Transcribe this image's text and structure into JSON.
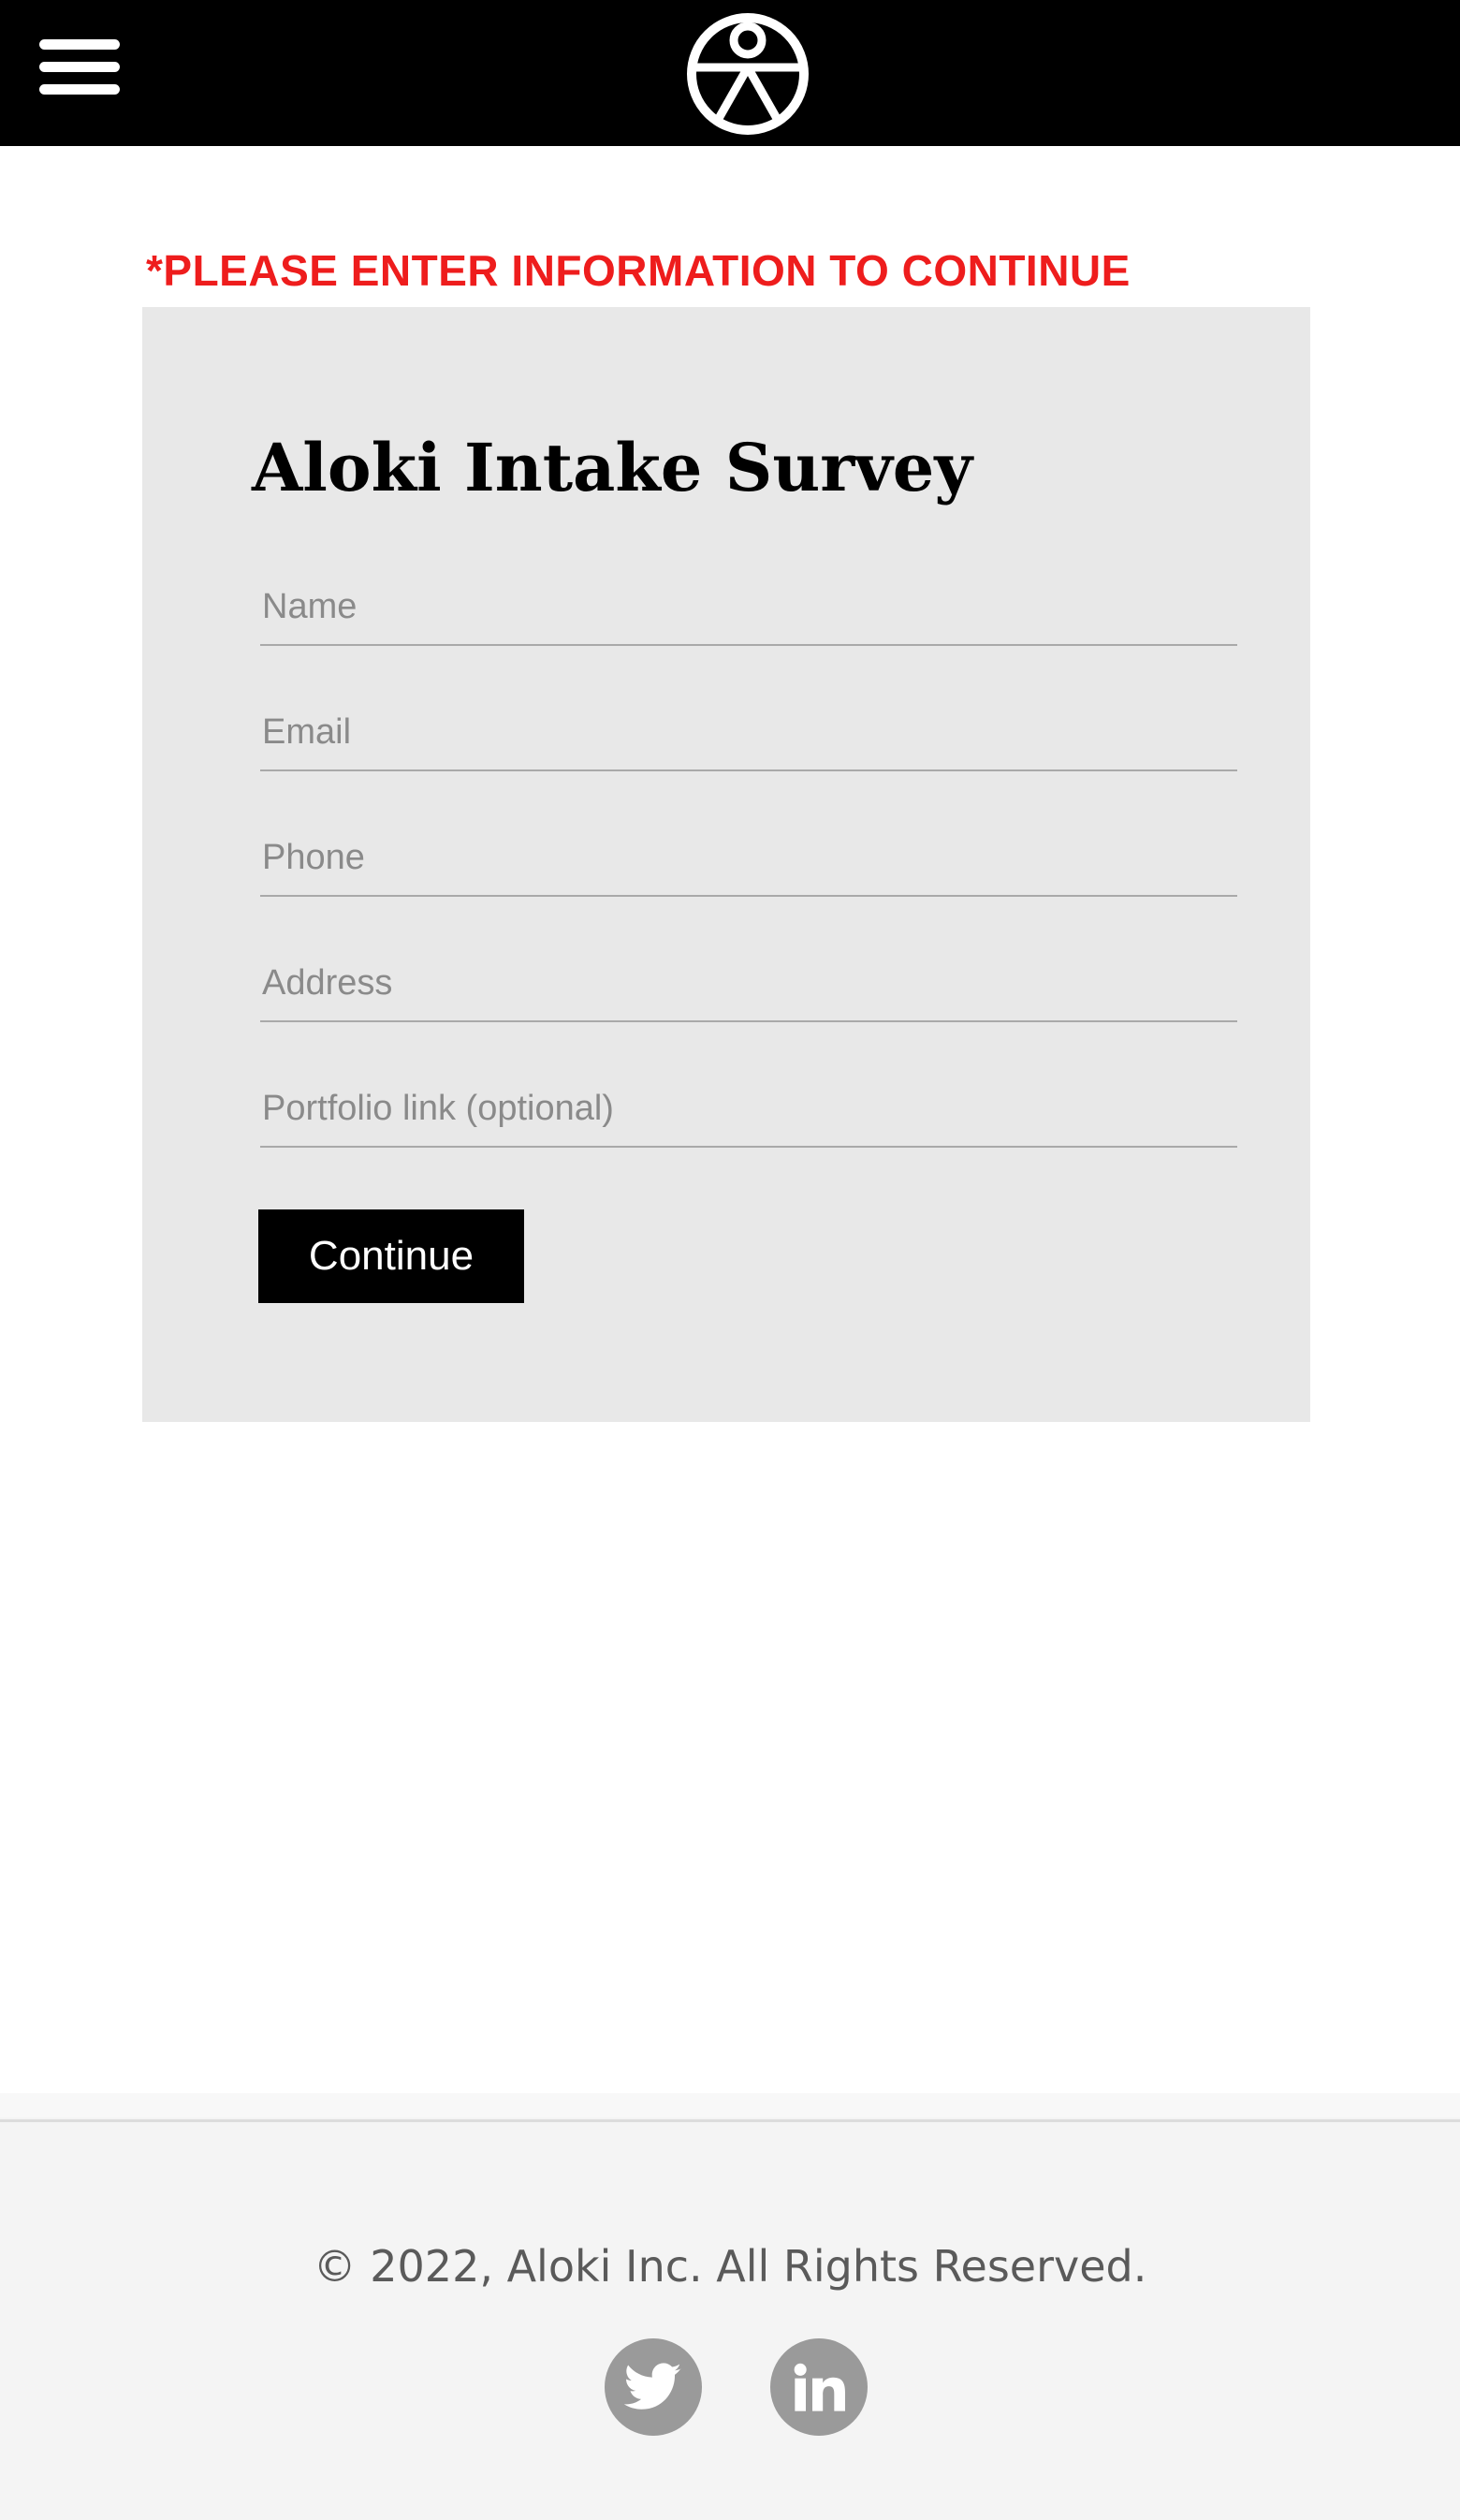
{
  "header": {
    "menu_icon": "hamburger-menu-icon",
    "logo_icon": "aloki-logo-icon",
    "background_color": "#000000"
  },
  "notice": {
    "text": "*PLEASE ENTER INFORMATION TO CONTINUE",
    "color": "#ee1d1d"
  },
  "form": {
    "title": "Aloki Intake Survey",
    "fields": [
      {
        "placeholder": "Name",
        "value": ""
      },
      {
        "placeholder": "Email",
        "value": ""
      },
      {
        "placeholder": "Phone",
        "value": ""
      },
      {
        "placeholder": "Address",
        "value": ""
      },
      {
        "placeholder": "Portfolio link (optional)",
        "value": ""
      }
    ],
    "submit_label": "Continue",
    "background_color": "#e8e8e8"
  },
  "footer": {
    "copyright": "© 2022, Aloki Inc. All Rights Reserved.",
    "social": [
      {
        "icon": "twitter-icon"
      },
      {
        "icon": "linkedin-icon"
      }
    ]
  }
}
